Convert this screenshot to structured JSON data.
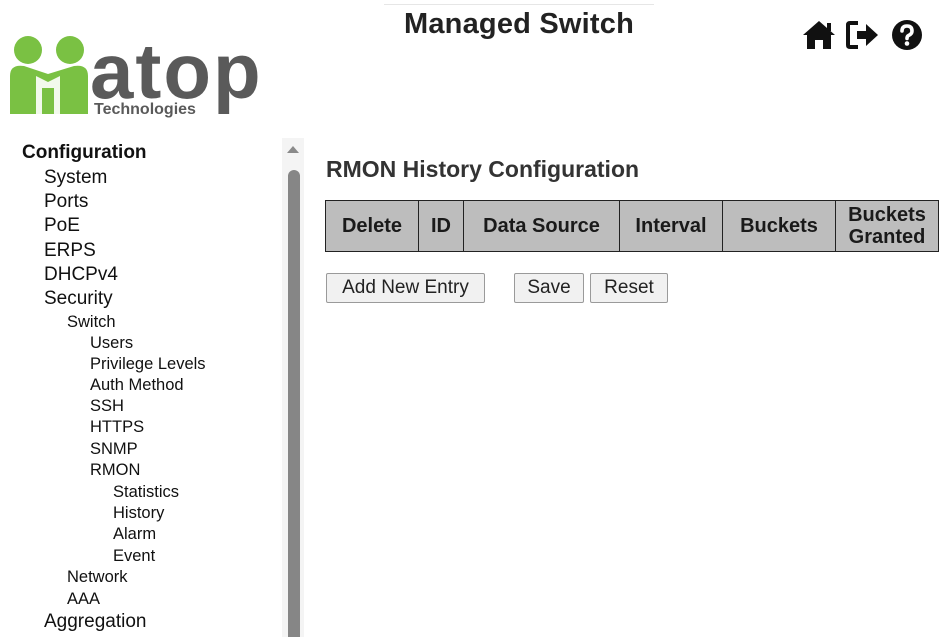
{
  "brand": {
    "logo_text": "atop",
    "logo_subtext": "Technologies",
    "logo_green": "#7ac143",
    "logo_gray": "#5a5a5a"
  },
  "header": {
    "title": "Managed Switch",
    "icons": [
      "home-icon",
      "logout-icon",
      "help-icon"
    ]
  },
  "sidebar": {
    "items": [
      {
        "label": "Configuration",
        "level": 0
      },
      {
        "label": "System",
        "level": 1
      },
      {
        "label": "Ports",
        "level": 1
      },
      {
        "label": "PoE",
        "level": 1
      },
      {
        "label": "ERPS",
        "level": 1
      },
      {
        "label": "DHCPv4",
        "level": 1
      },
      {
        "label": "Security",
        "level": 1
      },
      {
        "label": "Switch",
        "level": 2
      },
      {
        "label": "Users",
        "level": 3
      },
      {
        "label": "Privilege Levels",
        "level": 3
      },
      {
        "label": "Auth Method",
        "level": 3
      },
      {
        "label": "SSH",
        "level": 3
      },
      {
        "label": "HTTPS",
        "level": 3
      },
      {
        "label": "SNMP",
        "level": 3
      },
      {
        "label": "RMON",
        "level": 3
      },
      {
        "label": "Statistics",
        "level": 4
      },
      {
        "label": "History",
        "level": 4
      },
      {
        "label": "Alarm",
        "level": 4
      },
      {
        "label": "Event",
        "level": 4
      },
      {
        "label": "Network",
        "level": 2
      },
      {
        "label": "AAA",
        "level": 2
      },
      {
        "label": "Aggregation",
        "level": 1
      }
    ]
  },
  "main": {
    "title": "RMON History Configuration",
    "table": {
      "headers": [
        "Delete",
        "ID",
        "Data Source",
        "Interval",
        "Buckets",
        "Buckets Granted"
      ],
      "rows": []
    },
    "buttons": {
      "add": "Add New Entry",
      "save": "Save",
      "reset": "Reset"
    }
  },
  "colors": {
    "table_header_bg": "#bdbdbd",
    "scroll_thumb": "#868686"
  }
}
